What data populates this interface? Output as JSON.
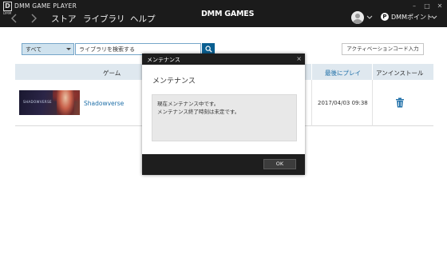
{
  "window": {
    "logo_letter": "D",
    "logo_sub": "DMM",
    "title": "DMM GAME PLAYER",
    "minimize": "–",
    "maximize": "□",
    "close": "✕"
  },
  "nav": {
    "tabs": [
      {
        "label": "ストア"
      },
      {
        "label": "ライブラリ"
      },
      {
        "label": "ヘルプ"
      }
    ],
    "brand": "DMM GAMES",
    "point_icon": "P",
    "points_label": "DMMポイント"
  },
  "toolbar": {
    "filter_value": "すべて",
    "search_placeholder": "ライブラリを検索する",
    "activation_label": "アクティベーションコード入力"
  },
  "table": {
    "headers": {
      "game": "ゲーム",
      "last_played": "最後にプレイ",
      "uninstall": "アンインストール"
    },
    "rows": [
      {
        "thumb_text": "SHADOWVERSE",
        "name": "Shadowverse",
        "last_played": "2017/04/03 09:38"
      }
    ]
  },
  "modal": {
    "title": "メンテナンス",
    "close": "×",
    "heading": "メンテナンス",
    "messages": [
      "現在メンテナンス中です。",
      "メンテナンス終了時刻は未定です。"
    ],
    "ok_label": "OK"
  },
  "colors": {
    "header_bg": "#1b1b1b",
    "accent_blue": "#0a5f91",
    "link_blue": "#1f6fa8",
    "table_header_bg": "#dfe8ef",
    "filter_bg": "#cfe2ee"
  },
  "icons": {
    "back": "chevron-left-icon",
    "forward": "chevron-right-icon",
    "search": "search-icon",
    "trash": "trash-icon",
    "avatar": "user-avatar-icon",
    "points": "points-icon"
  }
}
